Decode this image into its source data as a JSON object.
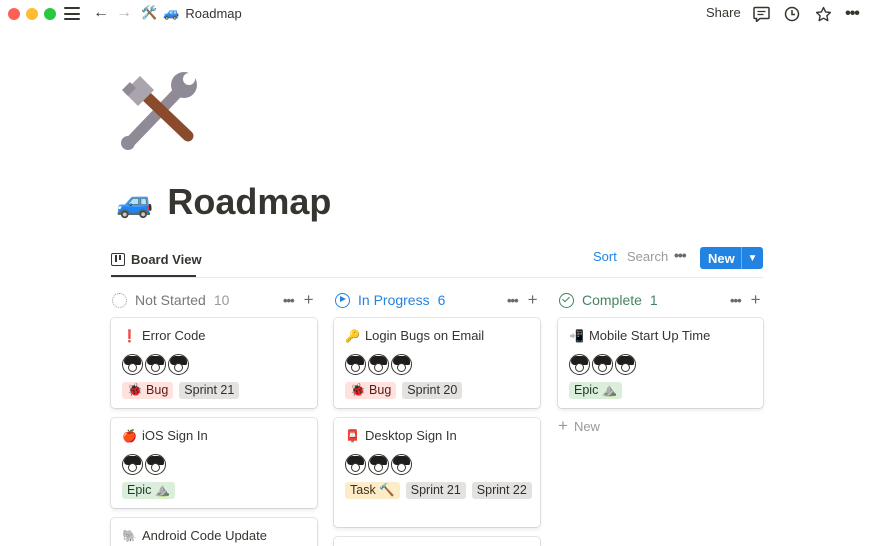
{
  "topbar": {
    "breadcrumb": {
      "workspace_icon": "🛠️",
      "page_icon": "🚙",
      "label": "Roadmap"
    },
    "share_label": "Share",
    "icons": [
      "comment-icon",
      "history-icon",
      "star-icon",
      "more-icon"
    ]
  },
  "page": {
    "icon": "hammer-and-wrench",
    "title_emoji": "🚙",
    "title": "Roadmap"
  },
  "viewbar": {
    "tab_label": "Board View",
    "sort_label": "Sort",
    "search_label": "Search",
    "new_label": "New"
  },
  "columns": [
    {
      "name": "Not Started",
      "count": "10",
      "color": "#9b9a97",
      "cards": [
        {
          "emoji": "❗",
          "title": "Error Code",
          "avatars": 3,
          "tags": [
            {
              "text": "🐞 Bug",
              "kind": "bug"
            },
            {
              "text": "Sprint 21",
              "kind": "sprint"
            }
          ]
        },
        {
          "emoji": "🍎",
          "title": "iOS Sign In",
          "avatars": 2,
          "tags": [
            {
              "text": "Epic ⛰️",
              "kind": "epic"
            }
          ]
        },
        {
          "emoji": "🐘",
          "title": "Android Code Update",
          "avatars": 0,
          "tags": []
        }
      ]
    },
    {
      "name": "In Progress",
      "count": "6",
      "color": "#2383e2",
      "cards": [
        {
          "emoji": "🔑",
          "title": "Login Bugs on Email",
          "avatars": 3,
          "tags": [
            {
              "text": "🐞 Bug",
              "kind": "bug"
            },
            {
              "text": "Sprint 20",
              "kind": "sprint"
            }
          ]
        },
        {
          "emoji": "📮",
          "title": "Desktop Sign In",
          "avatars": 3,
          "tags": [
            {
              "text": "Task 🔨",
              "kind": "task"
            },
            {
              "text": "Sprint 21",
              "kind": "sprint"
            },
            {
              "text": "Sprint 22",
              "kind": "sprint"
            }
          ]
        }
      ]
    },
    {
      "name": "Complete",
      "count": "1",
      "color": "#448361",
      "cards": [
        {
          "emoji": "📲",
          "title": "Mobile Start Up Time",
          "avatars": 3,
          "tags": [
            {
              "text": "Epic ⛰️",
              "kind": "epic"
            }
          ]
        }
      ],
      "new_label": "New"
    }
  ]
}
